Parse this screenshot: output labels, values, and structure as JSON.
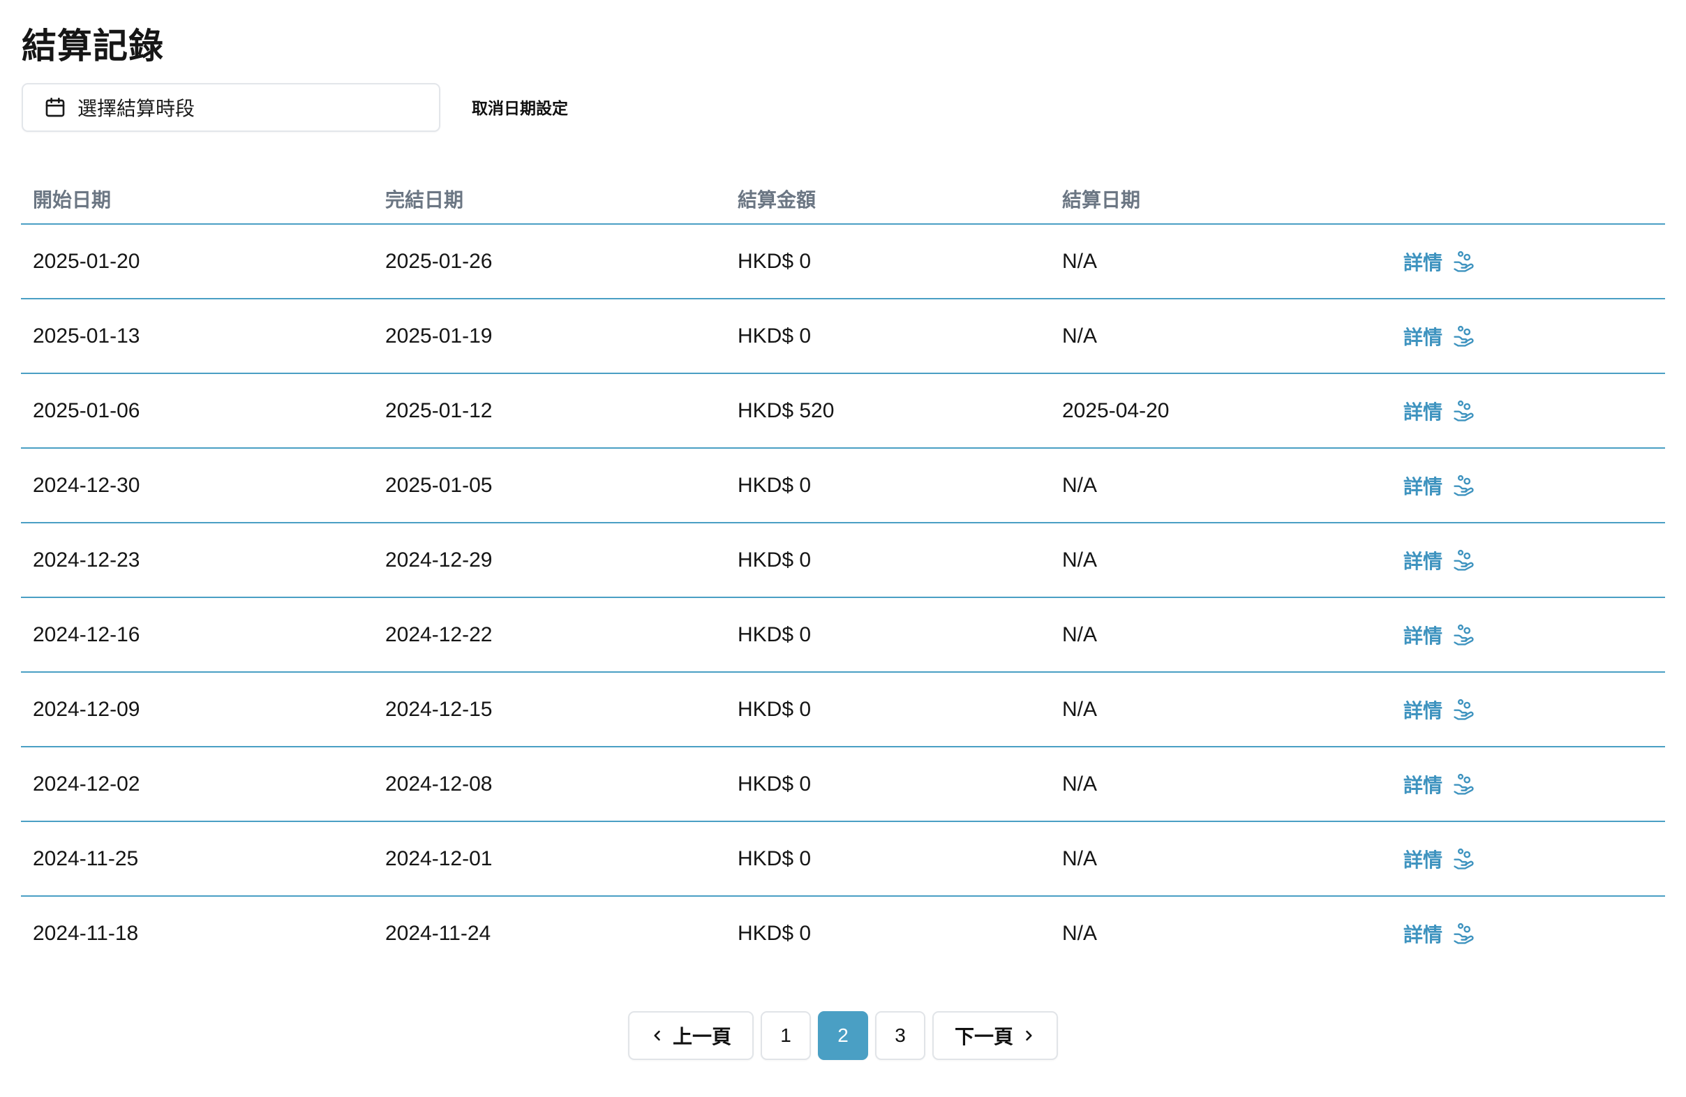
{
  "header": {
    "title": "結算記錄"
  },
  "filter": {
    "date_picker_label": "選擇結算時段",
    "clear_label": "取消日期設定"
  },
  "table": {
    "columns": [
      "開始日期",
      "完結日期",
      "結算金額",
      "結算日期",
      ""
    ],
    "detail_label": "詳情",
    "rows": [
      {
        "start": "2025-01-20",
        "end": "2025-01-26",
        "amount": "HKD$ 0",
        "settled": "N/A"
      },
      {
        "start": "2025-01-13",
        "end": "2025-01-19",
        "amount": "HKD$ 0",
        "settled": "N/A"
      },
      {
        "start": "2025-01-06",
        "end": "2025-01-12",
        "amount": "HKD$ 520",
        "settled": "2025-04-20"
      },
      {
        "start": "2024-12-30",
        "end": "2025-01-05",
        "amount": "HKD$ 0",
        "settled": "N/A"
      },
      {
        "start": "2024-12-23",
        "end": "2024-12-29",
        "amount": "HKD$ 0",
        "settled": "N/A"
      },
      {
        "start": "2024-12-16",
        "end": "2024-12-22",
        "amount": "HKD$ 0",
        "settled": "N/A"
      },
      {
        "start": "2024-12-09",
        "end": "2024-12-15",
        "amount": "HKD$ 0",
        "settled": "N/A"
      },
      {
        "start": "2024-12-02",
        "end": "2024-12-08",
        "amount": "HKD$ 0",
        "settled": "N/A"
      },
      {
        "start": "2024-11-25",
        "end": "2024-12-01",
        "amount": "HKD$ 0",
        "settled": "N/A"
      },
      {
        "start": "2024-11-18",
        "end": "2024-11-24",
        "amount": "HKD$ 0",
        "settled": "N/A"
      }
    ]
  },
  "pagination": {
    "prev_label": "上一頁",
    "next_label": "下一頁",
    "pages": [
      "1",
      "2",
      "3"
    ],
    "current": "2"
  },
  "icons": {
    "calendar": "calendar-icon",
    "detail": "hand-coins-icon",
    "prev": "chevron-left-icon",
    "next": "chevron-right-icon"
  },
  "colors": {
    "accent": "#4a9fc4",
    "link": "#3e93bf",
    "header_text": "#6b7683"
  }
}
